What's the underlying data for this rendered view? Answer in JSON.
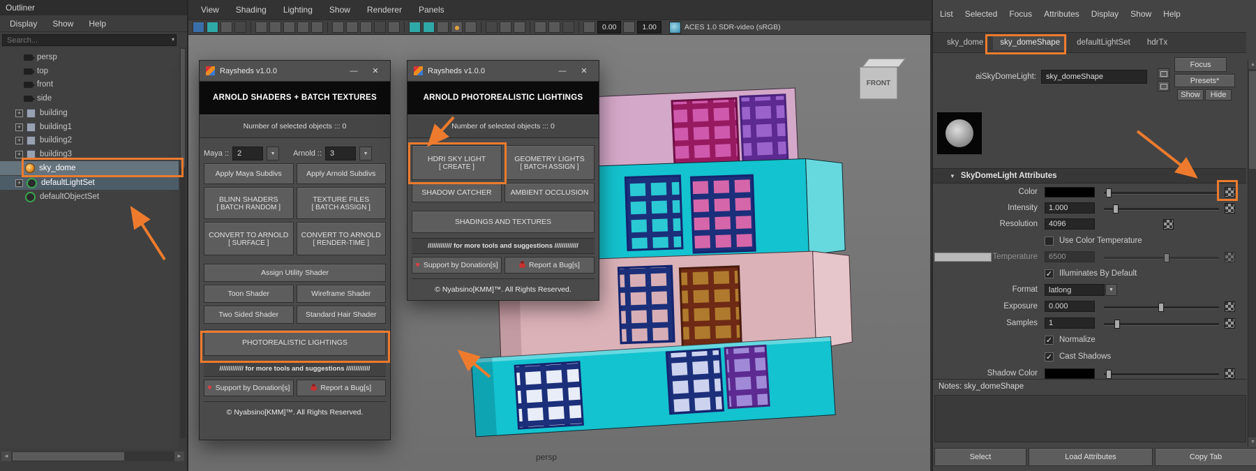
{
  "colors": {
    "annotation_accent": "#ee7b2d",
    "selection_highlight": "#4d5d68",
    "viewport_bg": "#757575",
    "building_cyan": "#13c3cf",
    "building_pink": "#d9b0b6",
    "building_lavender": "#d4a8c8"
  },
  "icons": {
    "expander_plus": "+",
    "caret_down": "▼",
    "caret_small": "▾",
    "minimize": "—",
    "close": "✕",
    "check": "✓",
    "arrow_up": "▲",
    "arrow_down": "▼",
    "arrow_left": "◄",
    "arrow_right": "►",
    "heart": "♥"
  },
  "outliner": {
    "title": "Outliner",
    "menus": [
      "Display",
      "Show",
      "Help"
    ],
    "search_placeholder": "Search...",
    "cameras": [
      "persp",
      "top",
      "front",
      "side"
    ],
    "groups": [
      "building",
      "building1",
      "building2",
      "building3"
    ],
    "light": "sky_dome",
    "sets": [
      "defaultLightSet",
      "defaultObjectSet"
    ]
  },
  "viewport": {
    "menus": [
      "View",
      "Shading",
      "Lighting",
      "Show",
      "Renderer",
      "Panels"
    ],
    "exposure_value": "0.00",
    "gamma_value": "1.00",
    "colorspace": "ACES 1.0 SDR-video (sRGB)",
    "camera_label": "persp",
    "viewcube_face": "FRONT"
  },
  "shaders_dialog": {
    "title": "Raysheds v1.0.0",
    "header": "ARNOLD SHADERS + BATCH TEXTURES",
    "selection_info": "Number of selected objects ::: 0",
    "maya_label": "Maya ::",
    "maya_value": "2",
    "arnold_label": "Arnold ::",
    "arnold_value": "3",
    "btn_apply_maya": "Apply Maya Subdivs",
    "btn_apply_arnold": "Apply Arnold Subdivs",
    "btn_blinn_1": "BLINN SHADERS",
    "btn_blinn_2": "[ BATCH RANDOM ]",
    "btn_texture_1": "TEXTURE FILES",
    "btn_texture_2": "[ BATCH ASSIGN ]",
    "btn_convert_surface_1": "CONVERT TO ARNOLD",
    "btn_convert_surface_2": "[ SURFACE ]",
    "btn_convert_rt_1": "CONVERT TO ARNOLD",
    "btn_convert_rt_2": "[ RENDER-TIME ]",
    "btn_assign_utility": "Assign Utility Shader",
    "btn_toon": "Toon Shader",
    "btn_wireframe": "Wireframe Shader",
    "btn_two_sided": "Two Sided Shader",
    "btn_hair": "Standard Hair Shader",
    "btn_photorealistic": "PHOTOREALISTIC LIGHTINGS",
    "more_tools": "/////////////  for more tools and suggestions  /////////////",
    "btn_support": "Support by Donation[s]",
    "btn_report": "Report a Bug[s]",
    "copyright": "© Nyabsino[KMM]™. All Rights Reserved."
  },
  "lighting_dialog": {
    "title": "Raysheds v1.0.0",
    "header": "ARNOLD PHOTOREALISTIC LIGHTINGS",
    "selection_info": "Number of selected objects ::: 0",
    "btn_hdri_1": "HDRI SKY LIGHT",
    "btn_hdri_2": "[ CREATE ]",
    "btn_geo_1": "GEOMETRY LIGHTS",
    "btn_geo_2": "[ BATCH ASSIGN ]",
    "btn_shadow_catcher": "SHADOW CATCHER",
    "btn_ambient": "AMBIENT OCCLUSION",
    "btn_shadings": "SHADINGS AND TEXTURES",
    "more_tools": "/////////////  for more tools and suggestions  /////////////",
    "btn_support": "Support by Donation[s]",
    "btn_report": "Report a Bug[s]",
    "copyright": "© Nyabsino[KMM]™. All Rights Reserved."
  },
  "attribute_editor": {
    "menus": [
      "List",
      "Selected",
      "Focus",
      "Attributes",
      "Display",
      "Show",
      "Help"
    ],
    "tabs": [
      "sky_dome",
      "sky_domeShape",
      "defaultLightSet",
      "hdrTx"
    ],
    "btn_focus": "Focus",
    "btn_presets": "Presets*",
    "btn_show": "Show",
    "btn_hide": "Hide",
    "node_type_label": "aiSkyDomeLight:",
    "node_name": "sky_domeShape",
    "section_title": "SkyDomeLight Attributes",
    "rows": {
      "color": {
        "label": "Color"
      },
      "intensity": {
        "label": "Intensity",
        "value": "1.000"
      },
      "resolution": {
        "label": "Resolution",
        "value": "4096"
      },
      "use_color_temperature": {
        "label": "Use Color Temperature"
      },
      "temperature": {
        "label": "Temperature",
        "value": "6500"
      },
      "illuminates": {
        "label": "Illuminates By Default"
      },
      "format": {
        "label": "Format",
        "value": "latlong"
      },
      "exposure": {
        "label": "Exposure",
        "value": "0.000"
      },
      "samples": {
        "label": "Samples",
        "value": "1"
      },
      "normalize": {
        "label": "Normalize"
      },
      "cast_shadows": {
        "label": "Cast Shadows"
      },
      "shadow_color": {
        "label": "Shadow Color"
      }
    },
    "notes_label": "Notes: sky_domeShape",
    "btn_select": "Select",
    "btn_load": "Load Attributes",
    "btn_copy": "Copy Tab"
  }
}
